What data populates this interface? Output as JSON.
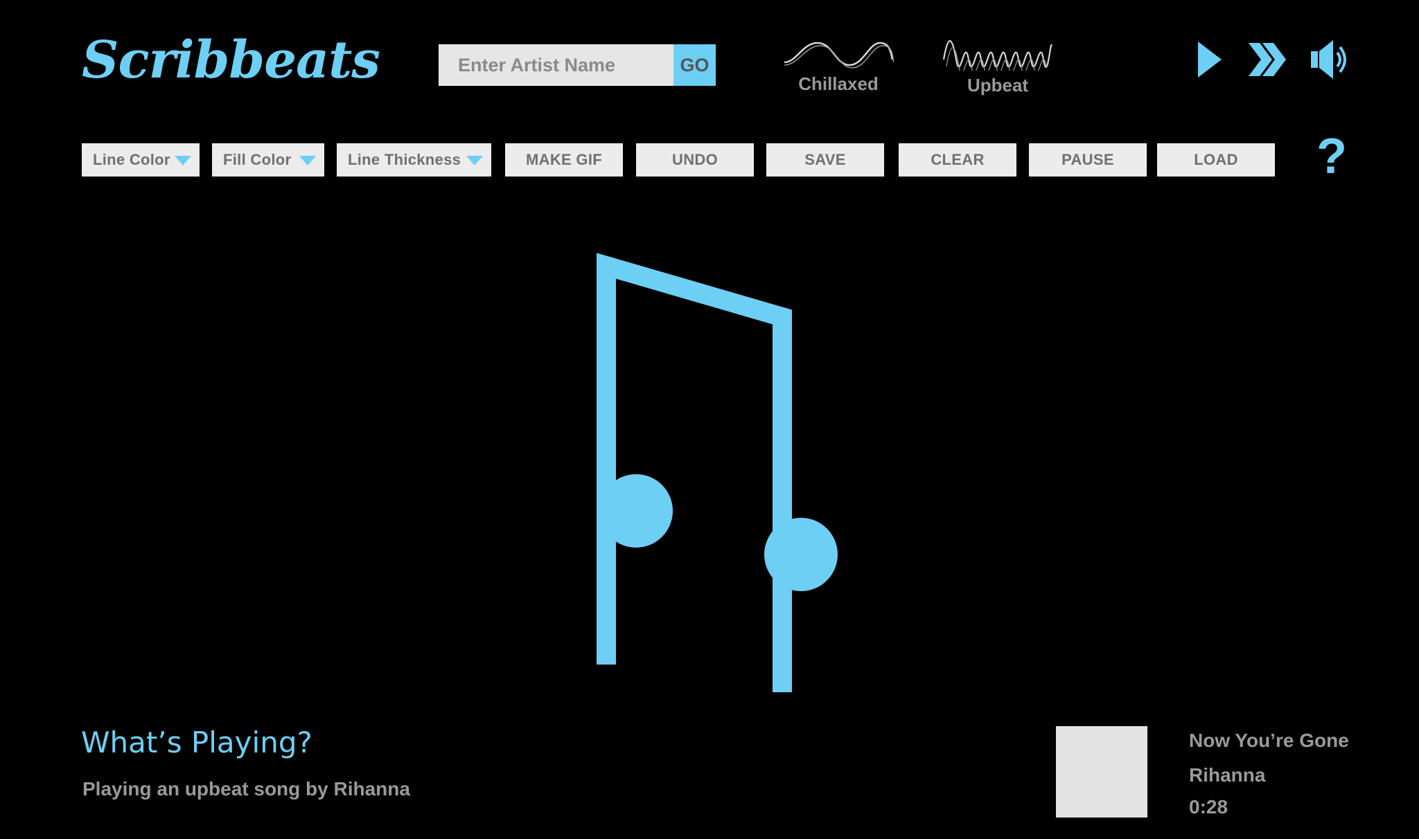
{
  "app": {
    "logo": "Scribbeats"
  },
  "search": {
    "placeholder": "Enter Artist Name",
    "go_label": "GO"
  },
  "moods": [
    {
      "label": "Chillaxed",
      "icon": "slow-wave-icon"
    },
    {
      "label": "Upbeat",
      "icon": "fast-wave-icon"
    }
  ],
  "transport": [
    "play-icon",
    "fast-forward-icon",
    "volume-icon"
  ],
  "toolbar": {
    "line_color": "Line Color",
    "fill_color": "Fill Color",
    "line_thickness": "Line Thickness",
    "make_gif": "MAKE GIF",
    "undo": "UNDO",
    "save": "SAVE",
    "clear": "CLEAR",
    "pause": "PAUSE",
    "load": "LOAD",
    "help": "?"
  },
  "canvas": {
    "drawing": "music-note-icon"
  },
  "now_playing": {
    "heading": "What’s Playing?",
    "description": "Playing an upbeat song by Rihanna",
    "track_title": "Now You’re Gone",
    "artist": "Rihanna",
    "time": "0:28"
  },
  "colors": {
    "accent": "#6ecff5",
    "background": "#000000",
    "button_bg": "#ececec",
    "text_muted": "#9a9a9a"
  }
}
